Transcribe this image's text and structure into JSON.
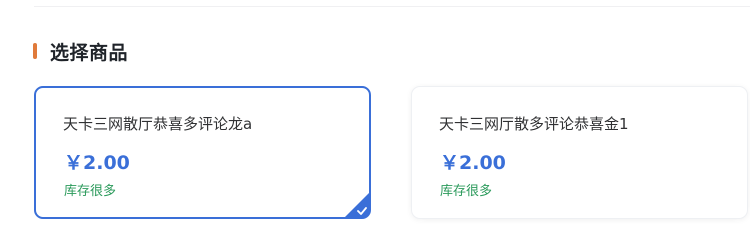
{
  "section": {
    "title": "选择商品",
    "accent_color": "#e07a3a"
  },
  "products": [
    {
      "name": "天卡三网散厅恭喜多评论龙a",
      "price": "￥2.00",
      "stock": "库存很多",
      "selected": true
    },
    {
      "name": "天卡三网厅散多评论恭喜金1",
      "price": "￥2.00",
      "stock": "库存很多",
      "selected": false
    }
  ],
  "colors": {
    "selected_border": "#3a6fd8",
    "price": "#3a6fd8",
    "stock": "#2b9a5b"
  },
  "icons": {
    "selected_indicator": "check-icon"
  }
}
